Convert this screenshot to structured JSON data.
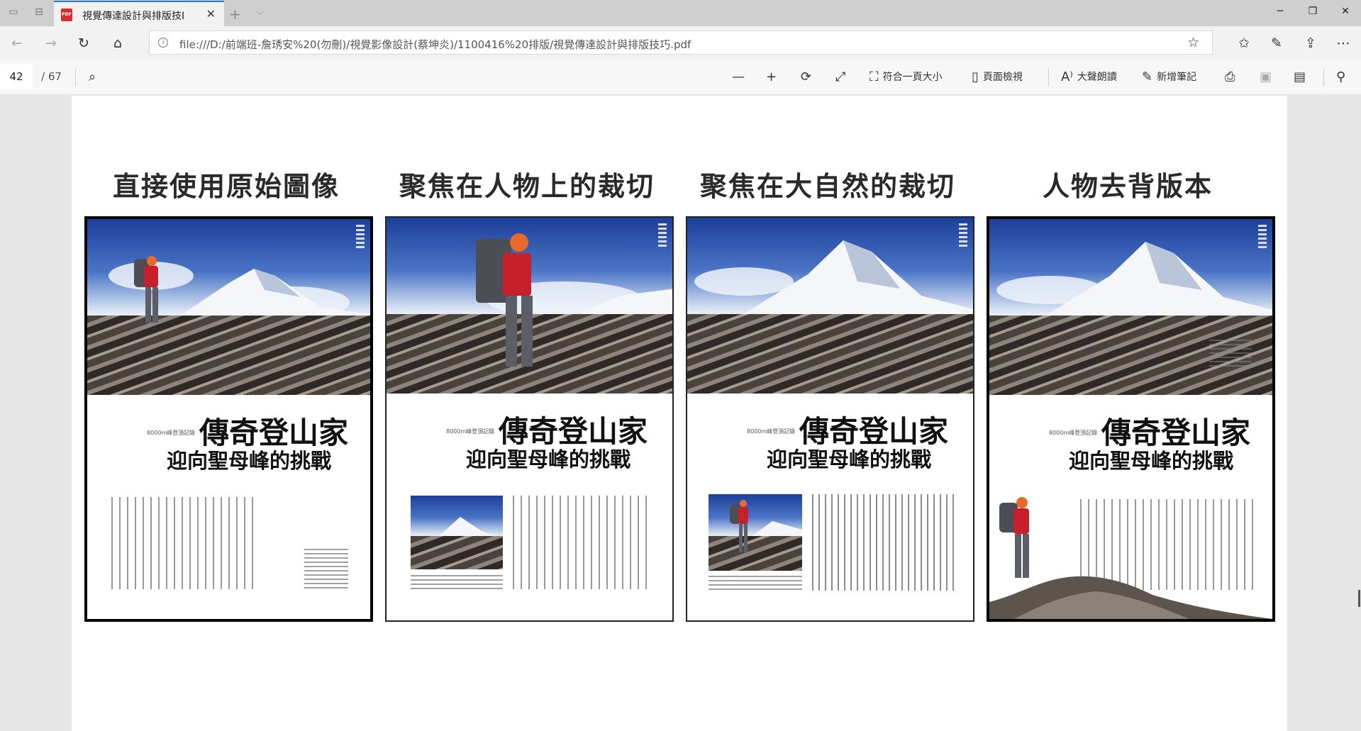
{
  "browser": {
    "tab_title": "視覺傳達設計與排版技I",
    "address_url": "file:///D:/前端班-詹琇安%20(勿刪)/視覺影像設計(蔡坤炎)/1100416%20排版/視覺傳達設計與排版技巧.pdf"
  },
  "pdf_toolbar": {
    "page_current": "42",
    "page_total": "/ 67",
    "fit_page_label": "符合一頁大小",
    "page_view_label": "頁面檢視",
    "read_aloud_label": "大聲朗讀",
    "add_notes_label": "新增筆記"
  },
  "document": {
    "panels": [
      {
        "heading": "直接使用原始圖像",
        "small_caption": "8000m峰登頂記錄",
        "headline_1": "傳奇登山家",
        "headline_2": "迎向聖母峰的挑戰"
      },
      {
        "heading": "聚焦在人物上的裁切",
        "small_caption": "8000m峰登頂記錄",
        "headline_1": "傳奇登山家",
        "headline_2": "迎向聖母峰的挑戰"
      },
      {
        "heading": "聚焦在大自然的裁切",
        "small_caption": "8000m峰登頂記錄",
        "headline_1": "傳奇登山家",
        "headline_2": "迎向聖母峰的挑戰"
      },
      {
        "heading": "人物去背版本",
        "small_caption": "8000m峰登頂記錄",
        "headline_1": "傳奇登山家",
        "headline_2": "迎向聖母峰的挑戰"
      }
    ]
  },
  "icons": [
    "sets-aside-icon",
    "tab-preview-icon",
    "pdf-file-icon",
    "close-icon",
    "new-tab-icon",
    "tab-list-icon",
    "minimize-icon",
    "restore-icon",
    "window-close-icon",
    "back-icon",
    "forward-icon",
    "refresh-icon",
    "home-icon",
    "info-icon",
    "favorite-star-icon",
    "favorites-icon",
    "pen-icon",
    "share-icon",
    "more-icon",
    "search-icon",
    "zoom-out-icon",
    "zoom-in-icon",
    "rotate-icon",
    "fullscreen-icon",
    "fit-page-icon",
    "page-view-icon",
    "read-aloud-icon",
    "add-notes-icon",
    "print-icon",
    "save-icon",
    "save-as-icon",
    "pin-icon"
  ],
  "colors": {
    "accent": "#2b79d8",
    "pdf_red": "#d32f2f",
    "hiker_red": "#c8202a"
  }
}
